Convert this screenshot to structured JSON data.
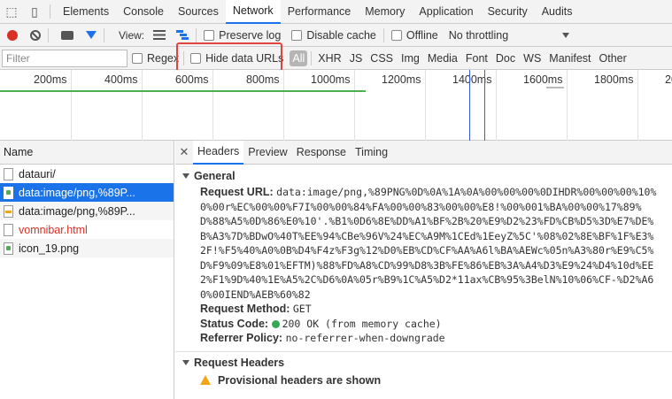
{
  "tabs": [
    "Elements",
    "Console",
    "Sources",
    "Network",
    "Performance",
    "Memory",
    "Application",
    "Security",
    "Audits"
  ],
  "toolbar": {
    "view_label": "View:",
    "preserve_log": "Preserve log",
    "disable_cache": "Disable cache",
    "offline": "Offline",
    "throttling": "No throttling"
  },
  "filterbar": {
    "filter_placeholder": "Filter",
    "regex": "Regex",
    "hide_data_urls": "Hide data URLs",
    "types": [
      "All",
      "XHR",
      "JS",
      "CSS",
      "Img",
      "Media",
      "Font",
      "Doc",
      "WS",
      "Manifest",
      "Other"
    ]
  },
  "timeline": {
    "ticks": [
      "200ms",
      "400ms",
      "600ms",
      "800ms",
      "1000ms",
      "1200ms",
      "1400ms",
      "1600ms",
      "1800ms",
      "20"
    ]
  },
  "request_list": {
    "header": "Name",
    "items": [
      {
        "name": "datauri/"
      },
      {
        "name": "data:image/png,%89P..."
      },
      {
        "name": "data:image/png,%89P..."
      },
      {
        "name": "vomnibar.html"
      },
      {
        "name": "icon_19.png"
      }
    ]
  },
  "detail_tabs": [
    "Headers",
    "Preview",
    "Response",
    "Timing"
  ],
  "general": {
    "title": "General",
    "request_url_label": "Request URL:",
    "request_url_lines": [
      "data:image/png,%89PNG%0D%0A%1A%0A%00%00%00%0DIHDR%00%00%00%10%",
      "0%00r%EC%00%00%F7I%00%00%84%FA%00%00%83%00%00%E8!%00%001%BA%00%00%17%89%",
      "D%88%A5%0D%86%E0%10'.%B1%0D6%8E%DD%A1%BF%2B%20%E9%D2%23%FD%CB%D5%3D%E7%DE%",
      "B%A3%7D%BDwO%40T%EE%94%CBe%96V%24%EC%A9M%1CEd%1EeyZ%5C'%08%02%8E%BF%1F%E3%",
      "2F!%F5%40%A0%0B%D4%F4z%F3g%12%D0%EB%CD%CF%AA%A6l%BA%AEWc%05n%A3%80r%E9%C5%",
      "D%F9%09%E8%01%EFTM)%88%FD%A8%CD%99%D8%3B%FE%86%EB%3A%A4%D3%E9%24%D4%10d%EE",
      "2%F1%9D%40%1E%A5%2C%D6%0A%05r%B9%1C%A5%D2*11ax%CB%95%3BelN%10%06%CF-%D2%A6",
      "0%00IEND%AEB%60%82"
    ],
    "request_method_label": "Request Method:",
    "request_method": "GET",
    "status_code_label": "Status Code:",
    "status_code": "200 OK (from memory cache)",
    "referrer_policy_label": "Referrer Policy:",
    "referrer_policy": "no-referrer-when-downgrade"
  },
  "request_headers": {
    "title": "Request Headers",
    "warning": "Provisional headers are shown"
  },
  "colors": {
    "accent": "#1a73e8",
    "record": "#d93025",
    "highlight_box": "#e0443e",
    "status_ok": "#34a853"
  }
}
